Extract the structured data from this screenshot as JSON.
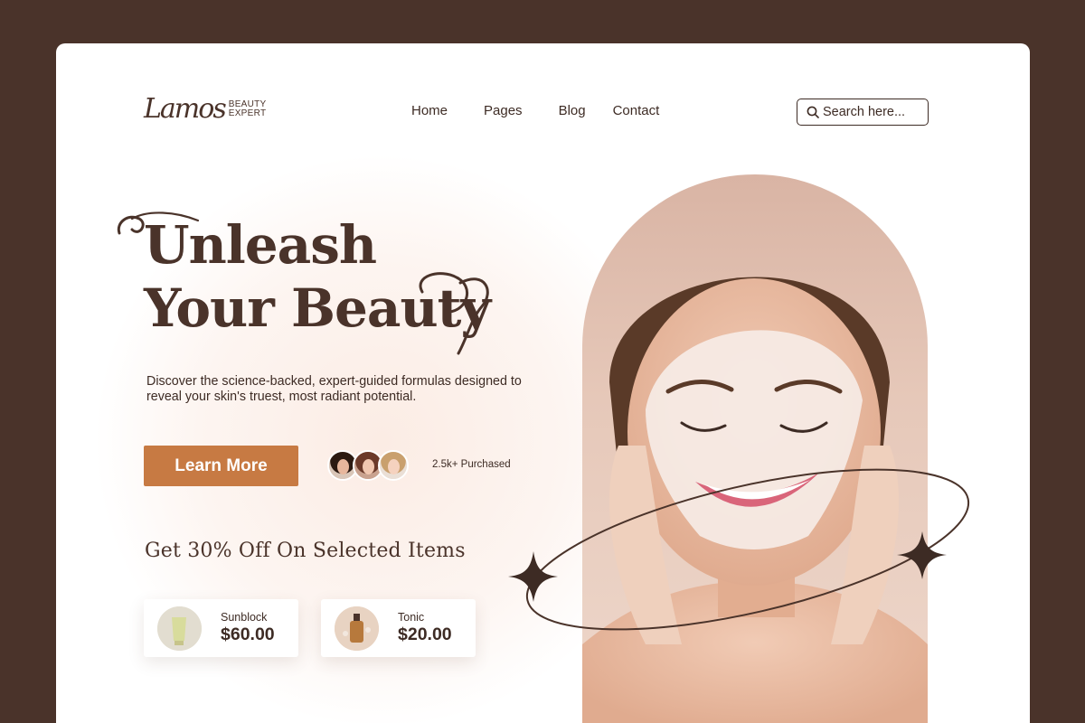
{
  "logo": {
    "mark": "Lamos",
    "line1": "BEAUTY",
    "line2": "EXPERT"
  },
  "nav": {
    "items": [
      {
        "label": "Home"
      },
      {
        "label": "Pages"
      },
      {
        "label": "Blog"
      },
      {
        "label": "Contact"
      }
    ]
  },
  "search": {
    "placeholder": "Search here...",
    "icon": "search-icon"
  },
  "hero": {
    "title_line1": "Unleash",
    "title_line2": "Your Beauty",
    "description": "Discover the science-backed, expert-guided formulas designed to reveal your skin's truest, most radiant potential.",
    "cta_label": "Learn More",
    "purchased_text": "2.5k+ Purchased"
  },
  "promo": {
    "title": "Get 30% Off On Selected Items"
  },
  "products": [
    {
      "name": "Sunblock",
      "price": "$60.00"
    },
    {
      "name": "Tonic",
      "price": "$20.00"
    }
  ],
  "colors": {
    "background": "#4a332a",
    "accent": "#c77a43",
    "text": "#3d2b24",
    "arch": "#d9b4a4"
  }
}
